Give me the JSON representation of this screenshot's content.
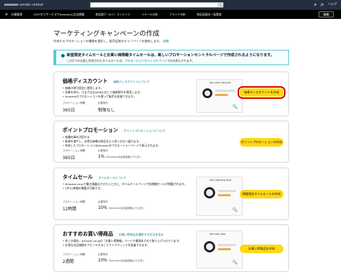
{
  "header": {
    "brand_prefix": "amazon",
    "brand_suffix": "vendor central",
    "search_placeholder": "",
    "search_btn": "🔍",
    "settings_icon": "gear-icon",
    "lang_label": "JA",
    "help_label": "ヘルプ"
  },
  "nav": {
    "items": [
      "在庫管理",
      "1507からサービスでAmazonに広告掲載",
      "商品紹介（A＋）コンテンツ",
      "リテール分析",
      "ブランド分析",
      "商品画面の一括登録"
    ],
    "button_label": "編集"
  },
  "page": {
    "title": "マーケティングキャンペーンの作成",
    "subtitle": "作成するプロモーションの種類を選択し、販売促進のキャンペーンを開始します。",
    "subtitle_link": "詳細"
  },
  "banner": {
    "title": "新型限定タイムセールとお買い得情報タイムセールは、新しいプロモーションセントラルページで作成されるようになります。",
    "body_prefix": "この2つの以前に作成されたタイムセールは、",
    "body_link": "プロモーションセントラルページ",
    "body_suffix": "でのみ表示されます。"
  },
  "cards": [
    {
      "title": "価格ディスカウント",
      "link": "価格ディスカウントについて",
      "bullets": [
        "• 価格の割引設定に使用します。",
        "• 在庫を持ち、さまざまなASINに対して価格割引を適用します。",
        "• Amazonのプロモーションを使って販売を促進できます。"
      ],
      "meta1_label": "プロモーション期間",
      "meta1_value": "365日",
      "meta2_label": "必要条件",
      "meta2_value": "制限なし",
      "meta2_small": "",
      "preview_title": "Your price discount",
      "action": "価格ディスカウントを作成"
    },
    {
      "title": "ポイントプロモーション",
      "link": "ポイントプロモーションについて",
      "bullets": [
        "• 各種在庫を活用する",
        "• 新規を増やし、お得な価格の商品をより多くの方へ届けます。",
        "• 作成したプロモーションはAmazonのプロモーションページで表示されます。"
      ],
      "meta1_label": "プロモーション期間",
      "meta1_value": "365日",
      "meta2_label": "必要条件",
      "meta2_value": "1%",
      "meta2_small": "のAmazon出品者価格よりも多く",
      "preview_title": "",
      "action": "ポイントプロモーションの作成"
    },
    {
      "title": "タイムセール",
      "link": "タイムセールについて",
      "bullets": [
        "• Amazon.co.jpで最大限露出させたいときに、タイムセールページで短期間セールが掲載されます。",
        "• 1件12時間の掲載が可能です。"
      ],
      "meta1_label": "プロモーション期間",
      "meta1_value": "12時間",
      "meta2_label": "必要条件",
      "meta2_value": "10%",
      "meta2_small": "のAmazon出品者価格よりも低く",
      "preview_title": "Your Lightning Deal",
      "action": "期間限定タイムセールの作成"
    },
    {
      "title": "おすすめお買い得商品",
      "link": "お買い得商品を選択する方法を見る",
      "bullets": [
        "• 多くの場合、Amazon.co.jpの「お買い得情報」ページで最適化されて取り上げられています。",
        "• お得な出品価格をアピールすることでトラフィックを促進できます。"
      ],
      "meta1_label": "プロモーション期間",
      "meta1_value": "2週間",
      "meta2_label": "必要条件",
      "meta2_value": "10%",
      "meta2_small": "のAmazon出品者価格よりも低く",
      "preview_title": "Your best deal",
      "action": "お買い得商品を作成"
    }
  ]
}
